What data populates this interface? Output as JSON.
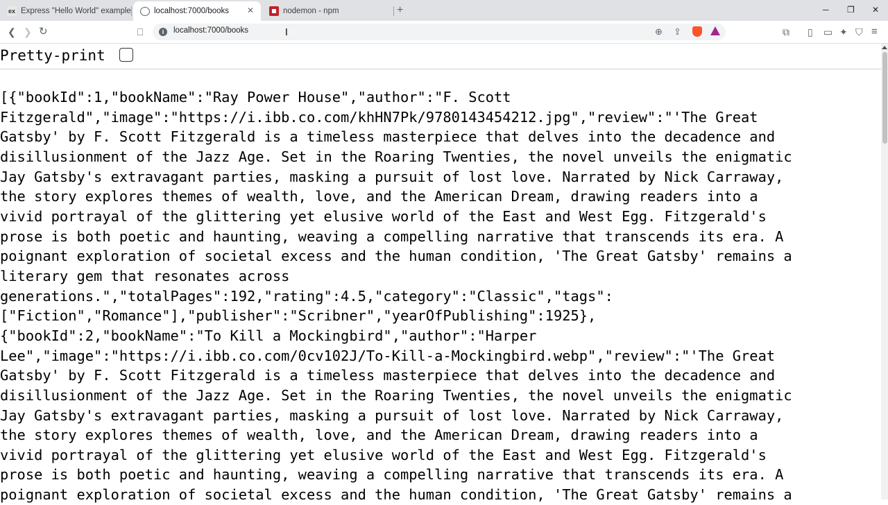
{
  "tabs": [
    {
      "favicon": "express-ex-icon",
      "fav_text": "ex",
      "title": "Express \"Hello World\" example"
    },
    {
      "favicon": "globe-icon",
      "title": "localhost:7000/books",
      "close": "✕"
    },
    {
      "favicon": "npm-icon",
      "title": "nodemon - npm"
    }
  ],
  "new_tab": "+",
  "window_controls": {
    "minimize": "─",
    "restore": "❐",
    "close": "✕"
  },
  "toolbar": {
    "back": "❮",
    "forward": "❯",
    "reload": "↻",
    "bookmark": "⎕"
  },
  "address_bar": {
    "url": "localhost:7000/books",
    "info": "i"
  },
  "omnibox_icons": {
    "zoom": "⊕",
    "share": "⇪"
  },
  "right_icons": [
    "⧉",
    "▯",
    "▭",
    "✦",
    "⛉",
    "≡"
  ],
  "pretty_print": {
    "label": "Pretty-print",
    "checked": false
  },
  "json_lines": [
    "[{\"bookId\":1,\"bookName\":\"Ray Power House\",\"author\":\"F. Scott",
    "Fitzgerald\",\"image\":\"https://i.ibb.co.com/khHN7Pk/9780143454212.jpg\",\"review\":\"'The Great",
    "Gatsby' by F. Scott Fitzgerald is a timeless masterpiece that delves into the decadence and",
    "disillusionment of the Jazz Age. Set in the Roaring Twenties, the novel unveils the enigmatic",
    "Jay Gatsby's extravagant parties, masking a pursuit of lost love. Narrated by Nick Carraway,",
    "the story explores themes of wealth, love, and the American Dream, drawing readers into a",
    "vivid portrayal of the glittering yet elusive world of the East and West Egg. Fitzgerald's",
    "prose is both poetic and haunting, weaving a compelling narrative that transcends its era. A",
    "poignant exploration of societal excess and the human condition, 'The Great Gatsby' remains a",
    "literary gem that resonates across",
    "generations.\",\"totalPages\":192,\"rating\":4.5,\"category\":\"Classic\",\"tags\":",
    "[\"Fiction\",\"Romance\"],\"publisher\":\"Scribner\",\"yearOfPublishing\":1925},",
    "{\"bookId\":2,\"bookName\":\"To Kill a Mockingbird\",\"author\":\"Harper",
    "Lee\",\"image\":\"https://i.ibb.co.com/0cv102J/To-Kill-a-Mockingbird.webp\",\"review\":\"'The Great",
    "Gatsby' by F. Scott Fitzgerald is a timeless masterpiece that delves into the decadence and",
    "disillusionment of the Jazz Age. Set in the Roaring Twenties, the novel unveils the enigmatic",
    "Jay Gatsby's extravagant parties, masking a pursuit of lost love. Narrated by Nick Carraway,",
    "the story explores themes of wealth, love, and the American Dream, drawing readers into a",
    "vivid portrayal of the glittering yet elusive world of the East and West Egg. Fitzgerald's",
    "prose is both poetic and haunting, weaving a compelling narrative that transcends its era. A",
    "poignant exploration of societal excess and the human condition, 'The Great Gatsby' remains a"
  ],
  "colors": {
    "tabstrip": "#dfe1e5",
    "omnibox": "#f1f3f4",
    "brave": "#fb542b",
    "bat": "#a3278f",
    "npm": "#c12127"
  }
}
